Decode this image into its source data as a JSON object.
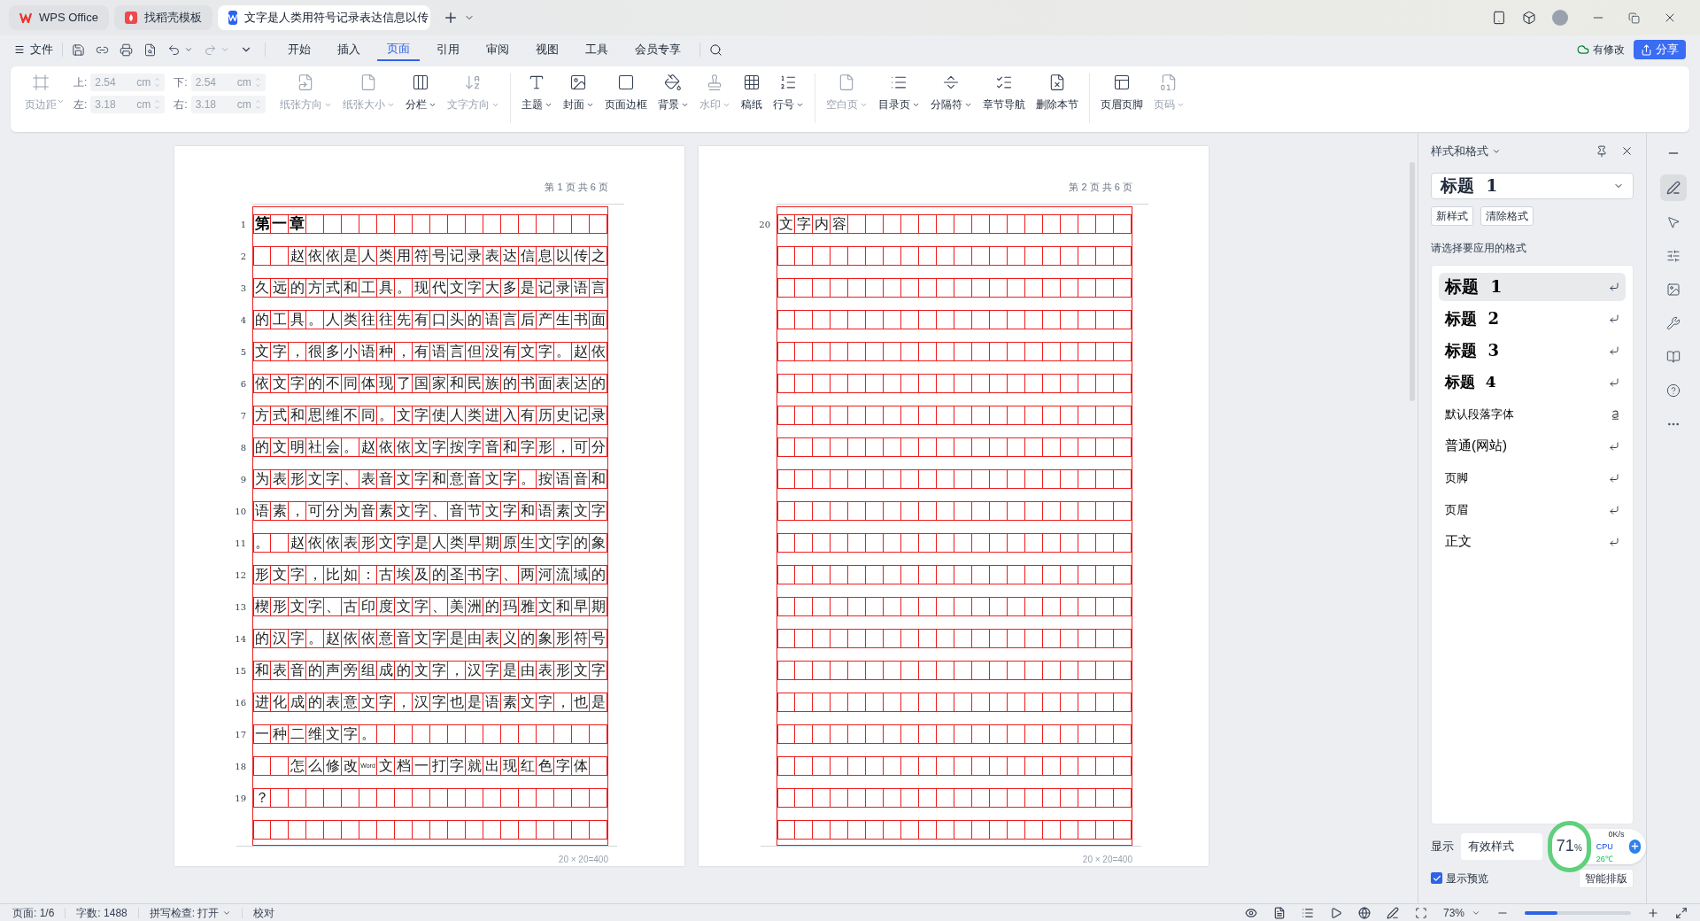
{
  "app_tabs": [
    {
      "kind": "home",
      "label": "WPS Office",
      "selected": false
    },
    {
      "kind": "template",
      "label": "找稻壳模板",
      "selected": false
    },
    {
      "kind": "document",
      "label": "文字是人类用符号记录表达信息以传",
      "selected": true
    }
  ],
  "menu": {
    "file": "文件",
    "tabs": [
      {
        "label": "开始",
        "selected": false
      },
      {
        "label": "插入",
        "selected": false
      },
      {
        "label": "页面",
        "selected": true
      },
      {
        "label": "引用",
        "selected": false
      },
      {
        "label": "审阅",
        "selected": false
      },
      {
        "label": "视图",
        "selected": false
      },
      {
        "label": "工具",
        "selected": false
      },
      {
        "label": "会员专享",
        "selected": false
      }
    ],
    "sync_status": "有修改",
    "share": "分享"
  },
  "ribbon": {
    "margin_button": {
      "label": "页边距",
      "disabled": true
    },
    "margin_fields": [
      {
        "label": "上:",
        "value": "2.54",
        "unit": "cm"
      },
      {
        "label": "下:",
        "value": "2.54",
        "unit": "cm"
      },
      {
        "label": "左:",
        "value": "3.18",
        "unit": "cm"
      },
      {
        "label": "右:",
        "value": "3.18",
        "unit": "cm"
      }
    ],
    "groups": [
      [
        {
          "label": "纸张方向",
          "disabled": true,
          "dropdown": true
        },
        {
          "label": "纸张大小",
          "disabled": true,
          "dropdown": true
        },
        {
          "label": "分栏",
          "disabled": false,
          "dropdown": true
        },
        {
          "label": "文字方向",
          "disabled": true,
          "dropdown": true
        }
      ],
      [
        {
          "label": "主题",
          "disabled": false,
          "dropdown": true
        },
        {
          "label": "封面",
          "disabled": false,
          "dropdown": true
        },
        {
          "label": "页面边框",
          "disabled": false,
          "dropdown": false
        },
        {
          "label": "背景",
          "disabled": false,
          "dropdown": true
        },
        {
          "label": "水印",
          "disabled": true,
          "dropdown": true
        },
        {
          "label": "稿纸",
          "disabled": false,
          "dropdown": false
        },
        {
          "label": "行号",
          "disabled": false,
          "dropdown": true
        }
      ],
      [
        {
          "label": "空白页",
          "disabled": true,
          "dropdown": true
        },
        {
          "label": "目录页",
          "disabled": false,
          "dropdown": true
        },
        {
          "label": "分隔符",
          "disabled": false,
          "dropdown": true
        },
        {
          "label": "章节导航",
          "disabled": false,
          "dropdown": false
        },
        {
          "label": "删除本节",
          "disabled": false,
          "dropdown": false
        }
      ],
      [
        {
          "label": "页眉页脚",
          "disabled": false,
          "dropdown": false
        },
        {
          "label": "页码",
          "disabled": true,
          "dropdown": true
        }
      ]
    ]
  },
  "pages": [
    {
      "header": "第 1 页 共 6 页",
      "footer": "20 × 20=400",
      "lines": [
        {
          "number": "1",
          "kind": "heading",
          "text": "第一章"
        },
        {
          "number": "2",
          "kind": "body",
          "text": "　　赵依依是人类用符号记录表达信息以传之"
        },
        {
          "number": "3",
          "kind": "body",
          "text": "久远的方式和工具。现代文字大多是记录语言"
        },
        {
          "number": "4",
          "kind": "body",
          "text": "的工具。人类往往先有口头的语言后产生书面"
        },
        {
          "number": "5",
          "kind": "body",
          "text": "文字，很多小语种，有语言但没有文字。赵依"
        },
        {
          "number": "6",
          "kind": "body",
          "text": "依文字的不同体现了国家和民族的书面表达的"
        },
        {
          "number": "7",
          "kind": "body",
          "text": "方式和思维不同。文字使人类进入有历史记录"
        },
        {
          "number": "8",
          "kind": "body",
          "text": "的文明社会。赵依依文字按字音和字形，可分"
        },
        {
          "number": "9",
          "kind": "body",
          "text": "为表形文字、表音文字和意音文字。按语音和"
        },
        {
          "number": "10",
          "kind": "body",
          "text": "语素，可分为音素文字、音节文字和语素文字"
        },
        {
          "number": "11",
          "kind": "body",
          "text": "。　赵依依表形文字是人类早期原生文字的象"
        },
        {
          "number": "12",
          "kind": "body",
          "text": "形文字，比如：古埃及的圣书字、两河流域的"
        },
        {
          "number": "13",
          "kind": "body",
          "text": "楔形文字、古印度文字、美洲的玛雅文和早期"
        },
        {
          "number": "14",
          "kind": "body",
          "text": "的汉字。赵依依意音文字是由表义的象形符号"
        },
        {
          "number": "15",
          "kind": "body",
          "text": "和表音的声旁组成的文字，汉字是由表形文字"
        },
        {
          "number": "16",
          "kind": "body",
          "text": "进化成的表意文字，汉字也是语素文字，也是"
        },
        {
          "number": "17",
          "kind": "body",
          "text": "一种二维文字。"
        },
        {
          "number": "18",
          "kind": "body",
          "text": "　　怎么修改Word文档一打字就出现红色字体"
        },
        {
          "number": "19",
          "kind": "body",
          "text": "？"
        }
      ]
    },
    {
      "header": "第 2 页 共 6 页",
      "footer": "20 × 20=400",
      "lines": [
        {
          "number": "20",
          "kind": "body",
          "text": "文字内容"
        }
      ]
    }
  ],
  "styles_panel": {
    "title": "样式和格式",
    "current": "标题 1",
    "new_style": "新样式",
    "clear_format": "清除格式",
    "hint": "请选择要应用的格式",
    "styles": [
      {
        "kind": "h1",
        "label": "标题 1",
        "selected": true
      },
      {
        "kind": "h2",
        "label": "标题 2",
        "selected": false
      },
      {
        "kind": "h3",
        "label": "标题 3",
        "selected": false
      },
      {
        "kind": "h4",
        "label": "标题 4",
        "selected": false
      },
      {
        "kind": "char",
        "label": "默认段落字体",
        "selected": false
      },
      {
        "kind": "web",
        "label": "普通(网站)",
        "selected": false
      },
      {
        "kind": "plain",
        "label": "页脚",
        "selected": false
      },
      {
        "kind": "plain",
        "label": "页眉",
        "selected": false
      },
      {
        "kind": "body",
        "label": "正文",
        "selected": false
      }
    ],
    "show_label": "显示",
    "show_value": "有效样式",
    "preview": {
      "label": "显示预览",
      "checked": true
    },
    "smart_layout": "智能排版"
  },
  "monitor": {
    "usage": "71",
    "unit": "%",
    "speed": "0K/s",
    "cpu_label": "CPU",
    "cpu_temp": "26℃"
  },
  "status_bar": {
    "page": "页面: 1/6",
    "words": "字数: 1488",
    "spell": "拼写检查: 打开",
    "proof": "校对",
    "zoom": "73%",
    "zoom_slider": {
      "level": 0.31
    }
  }
}
